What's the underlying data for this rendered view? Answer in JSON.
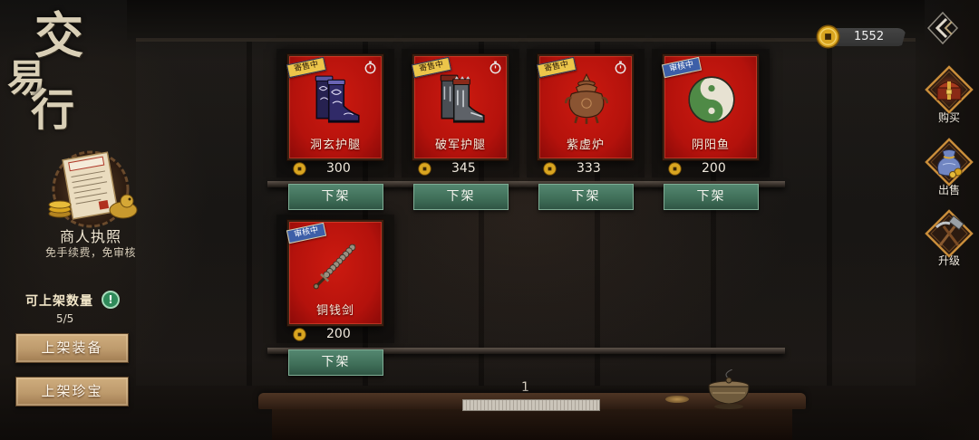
{
  "screen_title": {
    "chars": [
      "交",
      "易",
      "行"
    ]
  },
  "license": {
    "icon": "merchant-license-icon",
    "title": "商人执照",
    "subtitle": "免手续费，免审核"
  },
  "capacity": {
    "label": "可上架数量",
    "info_icon": "exclamation-icon",
    "info_glyph": "!",
    "value": "5/5"
  },
  "side_buttons": {
    "list_equipment": "上架装备",
    "list_treasure": "上架珍宝"
  },
  "currency": {
    "icon": "copper-coin-icon",
    "amount": 1552
  },
  "nav": {
    "back_icon": "back-arrow-icon",
    "items": [
      {
        "label": "购买",
        "icon": "treasure-chest-icon"
      },
      {
        "label": "出售",
        "icon": "money-bag-icon"
      },
      {
        "label": "升级",
        "icon": "hammer-icon"
      }
    ]
  },
  "listings": [
    {
      "name": "洞玄护腿",
      "price": 300,
      "status": "寄售中",
      "status_color": "#ecc54a",
      "timer_icon": "stopwatch-icon",
      "item_icon": "purple-boots-icon",
      "price_icon": "copper-coin-icon",
      "action": "下架"
    },
    {
      "name": "破军护腿",
      "price": 345,
      "status": "寄售中",
      "status_color": "#ecc54a",
      "timer_icon": "stopwatch-icon",
      "item_icon": "silver-boots-icon",
      "price_icon": "copper-coin-icon",
      "action": "下架"
    },
    {
      "name": "紫虚炉",
      "price": 333,
      "status": "寄售中",
      "status_color": "#ecc54a",
      "timer_icon": "stopwatch-icon",
      "item_icon": "incense-burner-icon",
      "price_icon": "copper-coin-icon",
      "action": "下架"
    },
    {
      "name": "阴阳鱼",
      "price": 200,
      "status": "审核中",
      "status_color": "#3d5fa8",
      "item_icon": "yin-yang-icon",
      "price_icon": "copper-coin-icon",
      "action": "下架"
    },
    {
      "name": "铜钱剑",
      "price": 200,
      "status": "审核中",
      "status_color": "#3d5fa8",
      "item_icon": "coin-sword-icon",
      "price_icon": "copper-coin-icon",
      "action": "下架"
    }
  ],
  "pagination": {
    "current_page": 1
  },
  "colors": {
    "card_red": "#b4120c",
    "action_green": "#3e6d57",
    "gold": "#d9a520",
    "title_beige": "#d9cfb6",
    "side_button_tan": "#bd9a6c"
  }
}
